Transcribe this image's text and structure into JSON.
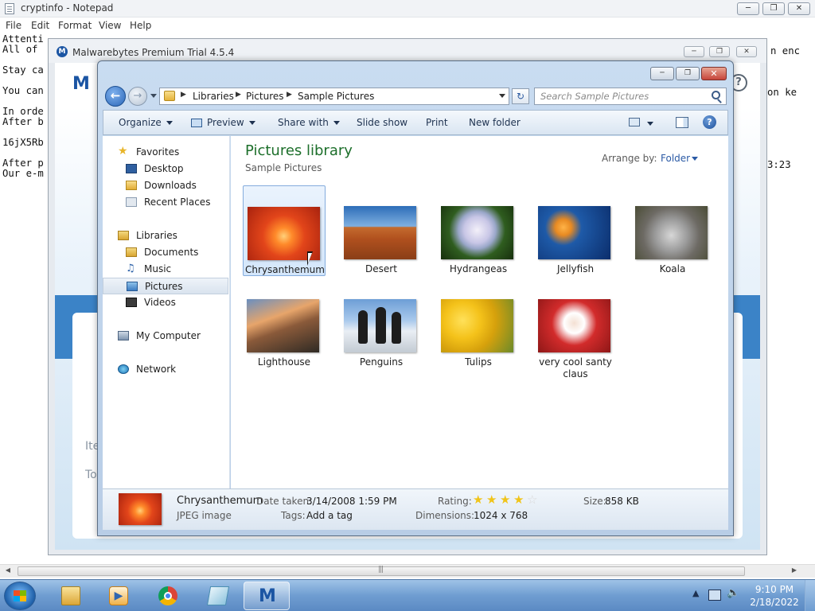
{
  "notepad": {
    "title": "cryptinfo - Notepad",
    "menu": [
      "File",
      "Edit",
      "Format",
      "View",
      "Help"
    ],
    "lines": [
      "Attenti",
      "All of",
      "",
      "Stay ca",
      "",
      "You can",
      "",
      "In orde",
      "After b",
      "",
      "16jX5Rb",
      "",
      "After p",
      "Our e-m"
    ],
    "right_fragments": [
      "n enc",
      "on ke",
      "3:23"
    ]
  },
  "malwarebytes": {
    "title": "Malwarebytes Premium Trial  4.5.4",
    "card_lines": [
      "Ite",
      "To"
    ]
  },
  "explorer": {
    "address": {
      "crumbs": [
        "Libraries",
        "Pictures",
        "Sample Pictures"
      ]
    },
    "search": {
      "placeholder": "Search Sample Pictures"
    },
    "commands": {
      "organize": "Organize",
      "preview": "Preview",
      "share_with": "Share with",
      "slide_show": "Slide show",
      "print": "Print",
      "new_folder": "New folder"
    },
    "nav": {
      "favorites": "Favorites",
      "desktop": "Desktop",
      "downloads": "Downloads",
      "recent_places": "Recent Places",
      "libraries": "Libraries",
      "documents": "Documents",
      "music": "Music",
      "pictures": "Pictures",
      "videos": "Videos",
      "my_computer": "My Computer",
      "network": "Network"
    },
    "library": {
      "title": "Pictures library",
      "subtitle": "Sample Pictures",
      "arrange_label": "Arrange by:",
      "arrange_value": "Folder"
    },
    "files": [
      {
        "name": "Chrysanthemum",
        "selected": true
      },
      {
        "name": "Desert",
        "selected": false
      },
      {
        "name": "Hydrangeas",
        "selected": false
      },
      {
        "name": "Jellyfish",
        "selected": false
      },
      {
        "name": "Koala",
        "selected": false
      },
      {
        "name": "Lighthouse",
        "selected": false
      },
      {
        "name": "Penguins",
        "selected": false
      },
      {
        "name": "Tulips",
        "selected": false
      },
      {
        "name": "very cool santy claus",
        "selected": false
      }
    ],
    "details": {
      "name": "Chrysanthemum",
      "type": "JPEG image",
      "date_taken_label": "Date taken:",
      "date_taken": "3/14/2008 1:59 PM",
      "tags_label": "Tags:",
      "tags": "Add a tag",
      "rating_label": "Rating:",
      "rating": 4,
      "rating_max": 5,
      "dimensions_label": "Dimensions:",
      "dimensions": "1024 x 768",
      "size_label": "Size:",
      "size": "858 KB"
    }
  },
  "taskbar": {
    "apps": [
      "explorer",
      "media-player",
      "chrome",
      "notepad",
      "malwarebytes"
    ],
    "active": "malwarebytes",
    "time": "9:10 PM",
    "date": "2/18/2022"
  }
}
